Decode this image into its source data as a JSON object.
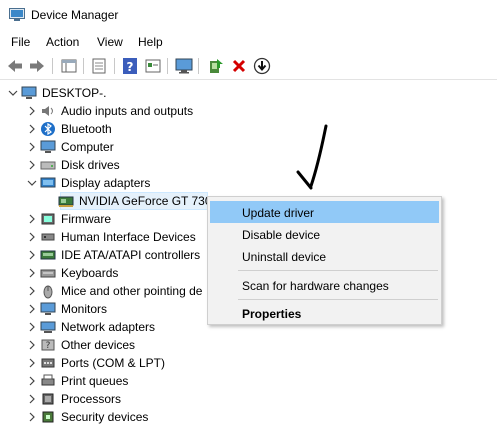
{
  "window": {
    "title": "Device Manager"
  },
  "menu": [
    "File",
    "Action",
    "View",
    "Help"
  ],
  "toolbar": [
    "back-arrow-icon",
    "forward-arrow-icon",
    "properties-grid-icon",
    "document-icon",
    "help-icon",
    "details-view-icon",
    "monitor-icon",
    "enable-driver-icon",
    "remove-device-icon",
    "download-icon"
  ],
  "tree": {
    "root": "DESKTOP-.",
    "categories": [
      {
        "label": "Audio inputs and outputs",
        "icon": "speaker-icon"
      },
      {
        "label": "Bluetooth",
        "icon": "bluetooth-icon"
      },
      {
        "label": "Computer",
        "icon": "computer-icon"
      },
      {
        "label": "Disk drives",
        "icon": "disk-drive-icon"
      },
      {
        "label": "Display adapters",
        "icon": "display-adapter-icon"
      },
      {
        "label": "NVIDIA GeForce GT 730",
        "icon": "gpu-card-icon"
      },
      {
        "label": "Firmware",
        "icon": "firmware-icon"
      },
      {
        "label": "Human Interface Devices",
        "icon": "hid-icon"
      },
      {
        "label": "IDE ATA/ATAPI controllers",
        "icon": "ide-controller-icon"
      },
      {
        "label": "Keyboards",
        "icon": "keyboard-icon"
      },
      {
        "label": "Mice and other pointing de",
        "icon": "mouse-icon"
      },
      {
        "label": "Monitors",
        "icon": "monitor-icon"
      },
      {
        "label": "Network adapters",
        "icon": "network-adapter-icon"
      },
      {
        "label": "Other devices",
        "icon": "unknown-device-icon"
      },
      {
        "label": "Ports (COM & LPT)",
        "icon": "port-icon"
      },
      {
        "label": "Print queues",
        "icon": "printer-icon"
      },
      {
        "label": "Processors",
        "icon": "processor-icon"
      },
      {
        "label": "Security devices",
        "icon": "security-device-icon"
      }
    ]
  },
  "context_menu": {
    "items": [
      "Update driver",
      "Disable device",
      "Uninstall device",
      "Scan for hardware changes",
      "Properties"
    ],
    "highlighted": "Update driver"
  }
}
